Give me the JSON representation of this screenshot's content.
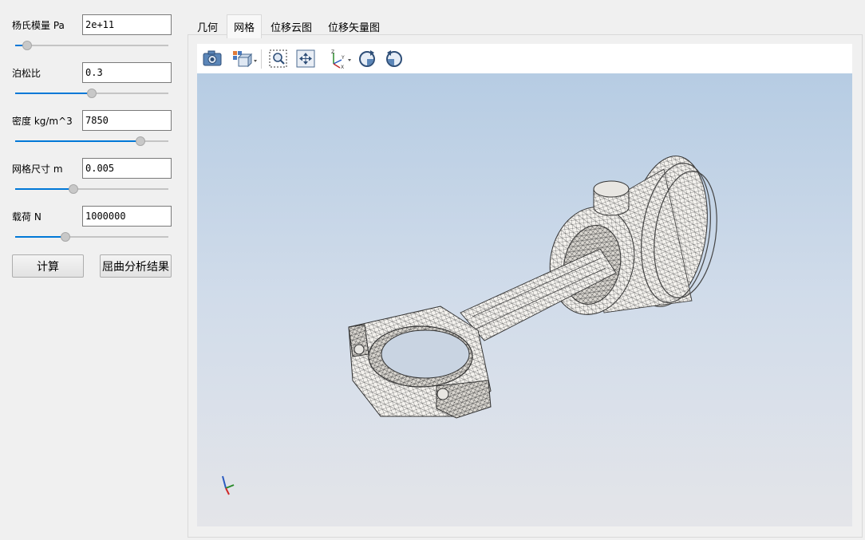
{
  "params": [
    {
      "label": "杨氏模量 Pa",
      "value": "2e+11",
      "slider_fraction": 0.08
    },
    {
      "label": "泊松比",
      "value": "0.3",
      "slider_fraction": 0.5
    },
    {
      "label": "密度 kg/m^3",
      "value": "7850",
      "slider_fraction": 0.82
    },
    {
      "label": "网格尺寸 m",
      "value": "0.005",
      "slider_fraction": 0.38
    },
    {
      "label": "载荷 N",
      "value": "1000000",
      "slider_fraction": 0.33
    }
  ],
  "buttons": {
    "compute": "计算",
    "buckling": "屈曲分析结果"
  },
  "tabs": [
    {
      "label": "几何",
      "active": false
    },
    {
      "label": "网格",
      "active": true
    },
    {
      "label": "位移云图",
      "active": false
    },
    {
      "label": "位移矢量图",
      "active": false
    }
  ],
  "toolbar": {
    "icons": [
      "camera-icon",
      "view-cube-icon",
      "zoom-box-icon",
      "fit-all-icon",
      "axes-view-icon",
      "rotate-cw-icon",
      "rotate-ccw-icon"
    ]
  },
  "colors": {
    "accent": "#0078d7",
    "viewport_top": "#b6cce3",
    "viewport_bottom": "#e4e5e9",
    "mesh": "#4a4a4a",
    "model_fill": "#f4f2ee"
  }
}
